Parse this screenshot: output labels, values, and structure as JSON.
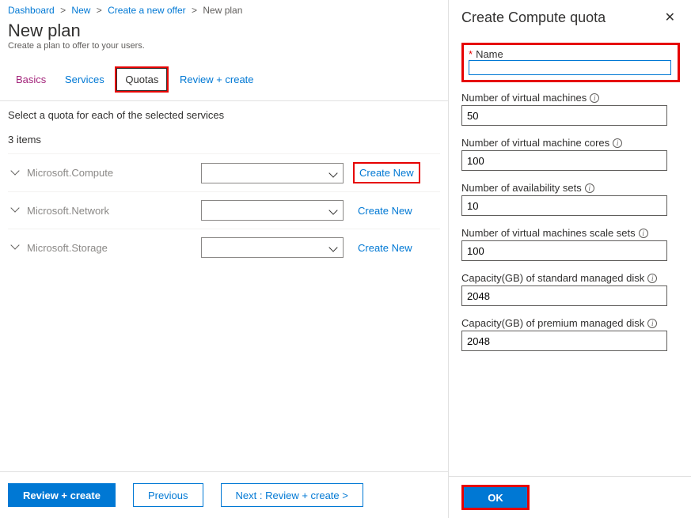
{
  "breadcrumbs": {
    "dashboard": "Dashboard",
    "new": "New",
    "create_offer": "Create a new offer",
    "current": "New plan"
  },
  "page": {
    "title": "New plan",
    "subtitle": "Create a plan to offer to your users."
  },
  "tabs": {
    "basics": "Basics",
    "services": "Services",
    "quotas": "Quotas",
    "review": "Review + create"
  },
  "instructions": "Select a quota for each of the selected services",
  "items_count": "3 items",
  "services": [
    {
      "name": "Microsoft.Compute",
      "create_label": "Create New",
      "highlight": true
    },
    {
      "name": "Microsoft.Network",
      "create_label": "Create New",
      "highlight": false
    },
    {
      "name": "Microsoft.Storage",
      "create_label": "Create New",
      "highlight": false
    }
  ],
  "footer": {
    "review": "Review + create",
    "previous": "Previous",
    "next": "Next : Review + create  >"
  },
  "panel": {
    "title": "Create Compute quota",
    "name_label": "Name",
    "fields": [
      {
        "label": "Number of virtual machines",
        "value": "50"
      },
      {
        "label": "Number of virtual machine cores",
        "value": "100"
      },
      {
        "label": "Number of availability sets",
        "value": "10"
      },
      {
        "label": "Number of virtual machines scale sets",
        "value": "100"
      },
      {
        "label": "Capacity(GB) of standard managed disk",
        "value": "2048"
      },
      {
        "label": "Capacity(GB) of premium managed disk",
        "value": "2048"
      }
    ],
    "ok": "OK"
  }
}
